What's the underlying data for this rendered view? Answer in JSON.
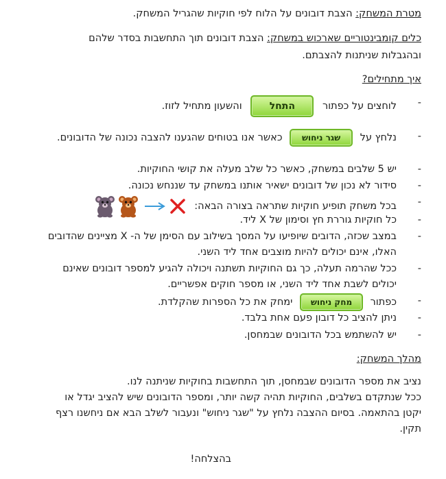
{
  "goal": {
    "label": "מטרת המשחק:",
    "text": " הצבת דובונים על הלוח לפי חוקיות שהגריל המשחק."
  },
  "tools": {
    "label": "כלים קומבינטוריים שארכוש במשחק:",
    "text": " הצבת דובונים תוך התחשבות בסדר שלהם",
    "line2": "ובהגבלות שניתנות להצבתם."
  },
  "howto": {
    "title": "איך מתחילים?"
  },
  "start_row": {
    "before": "לוחצים על כפתור",
    "button": "התחל",
    "after": "והשעון מתחיל לזוז."
  },
  "guess_row": {
    "before": "נלחץ על",
    "button": "שגר ניחוש",
    "after": "כאשר אנו בטוחים שהגענו להצבה נכונה של הדובונים."
  },
  "rules": {
    "r1": "יש 5 שלבים במשחק, כאשר כל שלב מעלה את קושי החוקיות.",
    "r2": "סידור לא נכון של דובונים ישאיר אותנו במשחק עד שננחש נכונה.",
    "r3": "בכל משחק תופיע חוקיות שתראה בצורה הבאה:",
    "r4": "כל חוקיות גוררת חץ וסימון של X ליד.",
    "r5a": "במצב שכזה, הדובים שיופיעו על המסך בשילוב עם הסימן של ה- X מציינים שהדובים",
    "r5b": "האלו, אינם יכולים להיות מוצבים אחד ליד השני.",
    "r6a": "ככל שהרמה תעלה, כך גם החוקיות תשתנה ויכולה להגיע למספר דובונים שאינם",
    "r6b": "יכולים לשבת אחד ליד השני, או מספר חוקים אפשריים.",
    "r7_before": "כפתור",
    "r7_button": "מחק ניחוש",
    "r7_after": "ימחק את כל הספרות שהקלדת.",
    "r8": "ניתן להציב כל דובון פעם אחת בלבד.",
    "r9": "יש להשתמש בכל הדובונים שבמחסן."
  },
  "flow": {
    "title": "מהלך המשחק:",
    "l1": "נציב את מספר הדובונים שבמחסן, תוך התחשבות בחוקיות שניתנה לנו.",
    "l2": "ככל שנתקדם בשלבים, החוקיות תהיה קשה יותר, ומספר הדובונים שיש להציב יגדל או",
    "l3": "יקטן בהתאמה. בסיום ההצבה נלחץ על \"שגר ניחוש\" ונעבור לשלב הבא אם ניחשנו רצף",
    "l4": "תקין."
  },
  "closing": "בהצלחה!",
  "colors": {
    "button_green": "#8fd63b",
    "arrow_blue": "#3a9bd9",
    "x_red": "#e02020",
    "bear_grey": "#6b5b6e",
    "bear_brown": "#b5561a"
  }
}
